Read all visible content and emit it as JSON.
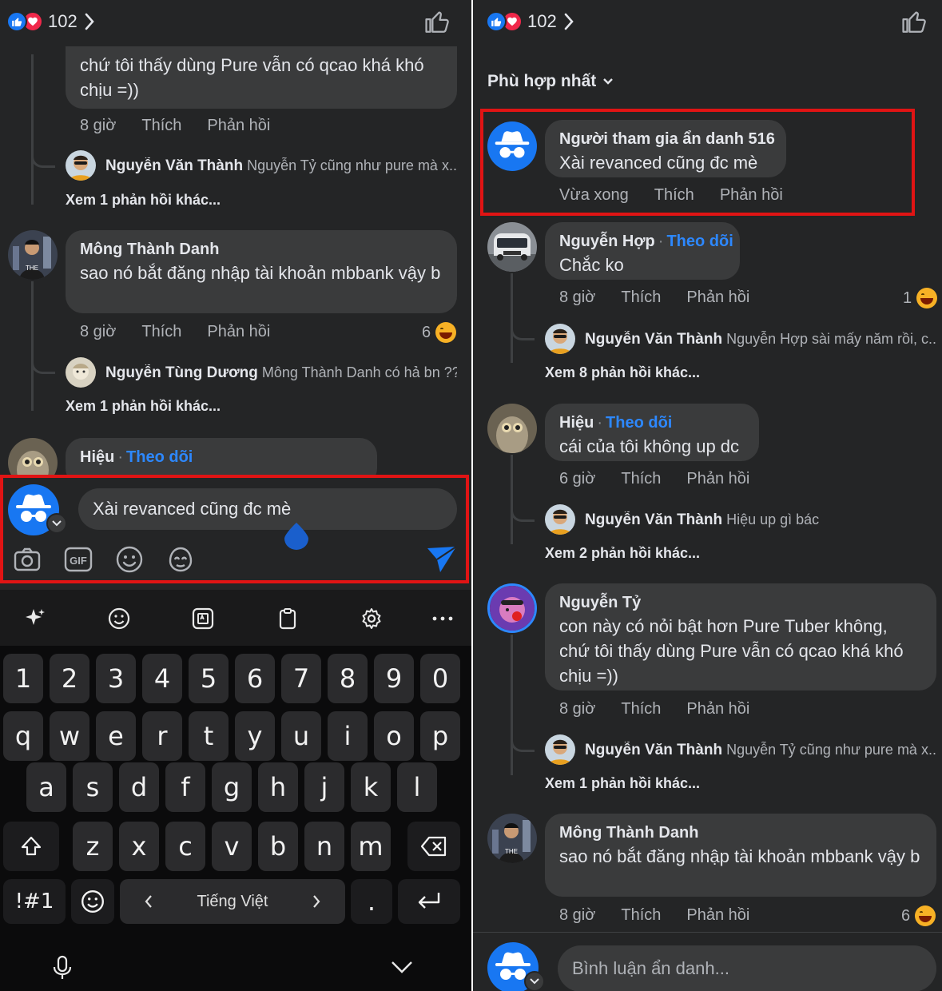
{
  "reaction_count": "102",
  "left": {
    "top_comment": {
      "text": "chứ tôi thấy dùng Pure vẫn có qcao khá khó chịu =))",
      "time": "8 giờ",
      "like": "Thích",
      "reply": "Phản hồi",
      "reply_preview": {
        "name": "Nguyễn Văn Thành",
        "text": "Nguyễn Tỷ cũng như pure mà x..."
      },
      "more_replies": "Xem 1 phản hồi khác..."
    },
    "comment2": {
      "name": "Mông Thành Danh",
      "text": "sao nó bắt đăng nhập tài khoản mbbank vậy b",
      "time": "8 giờ",
      "like": "Thích",
      "reply": "Phản hồi",
      "reaction_count": "6",
      "reply_preview": {
        "name": "Nguyễn Tùng Dương",
        "text": "Mông Thành Danh có hả bn ??"
      },
      "more_replies": "Xem 1 phản hồi khác..."
    },
    "comment3": {
      "name": "Hiệu",
      "follow": "Theo dõi"
    },
    "composer": {
      "value": "Xài revanced cũng đc mè"
    },
    "keyboard": {
      "row_numbers": [
        "1",
        "2",
        "3",
        "4",
        "5",
        "6",
        "7",
        "8",
        "9",
        "0"
      ],
      "row1": [
        "q",
        "w",
        "e",
        "r",
        "t",
        "y",
        "u",
        "i",
        "o",
        "p"
      ],
      "row2": [
        "a",
        "s",
        "d",
        "f",
        "g",
        "h",
        "j",
        "k",
        "l"
      ],
      "row3": [
        "z",
        "x",
        "c",
        "v",
        "b",
        "n",
        "m"
      ],
      "symbols": "!#1",
      "language": "Tiếng Việt",
      "period": "."
    }
  },
  "right": {
    "sort_label": "Phù hợp nhất",
    "comments": [
      {
        "name": "Người tham gia ẩn danh 516",
        "text": "Xài revanced cũng đc mè",
        "time": "Vừa xong",
        "like": "Thích",
        "reply": "Phản hồi"
      },
      {
        "name": "Nguyễn Hợp",
        "follow": "Theo dõi",
        "text": "Chắc ko",
        "time": "8 giờ",
        "like": "Thích",
        "reply": "Phản hồi",
        "reaction_count": "1",
        "reply_preview": {
          "name": "Nguyễn Văn Thành",
          "text": "Nguyễn Hợp sài mấy năm rồi, c..."
        },
        "more_replies": "Xem 8 phản hồi khác..."
      },
      {
        "name": "Hiệu",
        "follow": "Theo dõi",
        "text": "cái của tôi không up dc",
        "time": "6 giờ",
        "like": "Thích",
        "reply": "Phản hồi",
        "reply_preview": {
          "name": "Nguyễn Văn Thành",
          "text": "Hiệu up gì bác"
        },
        "more_replies": "Xem 2 phản hồi khác..."
      },
      {
        "name": "Nguyễn Tỷ",
        "text": "con này có nỏi bật hơn Pure Tuber không, chứ tôi thấy dùng Pure vẫn có qcao khá khó chịu =))",
        "time": "8 giờ",
        "like": "Thích",
        "reply": "Phản hồi",
        "reply_preview": {
          "name": "Nguyễn Văn Thành",
          "text": "Nguyễn Tỷ cũng như pure mà x..."
        },
        "more_replies": "Xem 1 phản hồi khác..."
      },
      {
        "name": "Mông Thành Danh",
        "text": "sao nó bắt đăng nhập tài khoản mbbank vậy b",
        "time": "8 giờ",
        "like": "Thích",
        "reply": "Phản hồi",
        "reaction_count": "6"
      }
    ],
    "composer": {
      "placeholder": "Bình luận ẩn danh..."
    }
  },
  "colors": {
    "background": "#242526",
    "bubble": "#3a3b3c",
    "accent": "#2d88ff",
    "highlight": "#e01414",
    "send": "#1877f2"
  }
}
